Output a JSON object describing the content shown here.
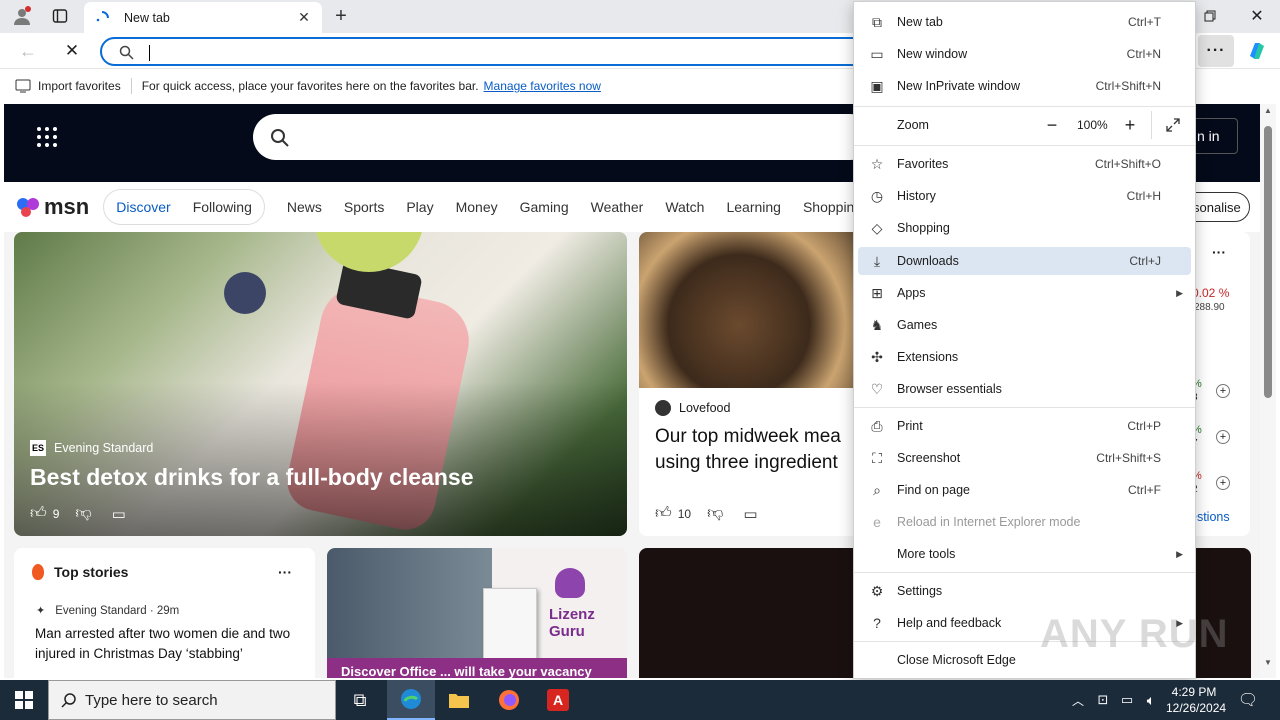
{
  "tab": {
    "title": "New tab"
  },
  "favbar": {
    "import_label": "Import favorites",
    "hint": "For quick access, place your favorites here on the favorites bar.",
    "manage_link": "Manage favorites now"
  },
  "msn": {
    "logo": "msn",
    "sign_in_fragment": "n in",
    "personalise_fragment": "sonalise",
    "tabs": [
      "Discover",
      "Following"
    ],
    "nav": [
      "News",
      "Sports",
      "Play",
      "Money",
      "Gaming",
      "Weather",
      "Watch",
      "Learning",
      "Shopping"
    ],
    "hero": {
      "source": "Evening Standard",
      "title": "Best detox drinks for a full-body cleanse",
      "likes": "9"
    },
    "food_card": {
      "source": "Lovefood",
      "title": "Our top midweek mea using three ingredient",
      "likes": "10"
    },
    "top_stories": {
      "heading": "Top stories",
      "source": "Evening Standard · 29m",
      "headline": "Man arrested after two women die and two injured in Christmas Day ‘stabbing’"
    },
    "ad_card": {
      "brand": "Lizenz Guru",
      "caption": "Discover Office ... will take your vacancy"
    },
    "widget": {
      "pct1": "0.02 %",
      "val1": "288.90",
      "suggestions": "estions",
      "pct_frag": "%",
      "num_frags": [
        "3",
        "7",
        "2"
      ]
    }
  },
  "menu": {
    "items": [
      {
        "label": "New tab",
        "shortcut": "Ctrl+T",
        "icon": "new-tab-icon"
      },
      {
        "label": "New window",
        "shortcut": "Ctrl+N",
        "icon": "new-window-icon"
      },
      {
        "label": "New InPrivate window",
        "shortcut": "Ctrl+Shift+N",
        "icon": "inprivate-icon"
      },
      {
        "label": "Zoom",
        "icon": ""
      },
      {
        "label": "Favorites",
        "shortcut": "Ctrl+Shift+O",
        "icon": "star-icon"
      },
      {
        "label": "History",
        "shortcut": "Ctrl+H",
        "icon": "history-icon"
      },
      {
        "label": "Shopping",
        "icon": "shopping-tag-icon"
      },
      {
        "label": "Downloads",
        "shortcut": "Ctrl+J",
        "icon": "download-icon"
      },
      {
        "label": "Apps",
        "icon": "apps-icon"
      },
      {
        "label": "Games",
        "icon": "games-icon"
      },
      {
        "label": "Extensions",
        "icon": "puzzle-icon"
      },
      {
        "label": "Browser essentials",
        "icon": "heart-pulse-icon"
      },
      {
        "label": "Print",
        "shortcut": "Ctrl+P",
        "icon": "printer-icon"
      },
      {
        "label": "Screenshot",
        "shortcut": "Ctrl+Shift+S",
        "icon": "screenshot-icon"
      },
      {
        "label": "Find on page",
        "shortcut": "Ctrl+F",
        "icon": "find-icon"
      },
      {
        "label": "Reload in Internet Explorer mode",
        "icon": "ie-mode-icon"
      },
      {
        "label": "More tools",
        "icon": ""
      },
      {
        "label": "Settings",
        "icon": "gear-icon"
      },
      {
        "label": "Help and feedback",
        "icon": "help-icon"
      },
      {
        "label": "Close Microsoft Edge",
        "icon": ""
      }
    ],
    "zoom_value": "100%"
  },
  "taskbar": {
    "search_placeholder": "Type here to search",
    "time": "4:29 PM",
    "date": "12/26/2024"
  },
  "watermark": "ANY RUN",
  "colors": {
    "accent": "#0a6cd6",
    "menu_highlight": "#dbe6f2",
    "msn_header": "#050a1a",
    "taskbar": "#1c2b3a"
  }
}
